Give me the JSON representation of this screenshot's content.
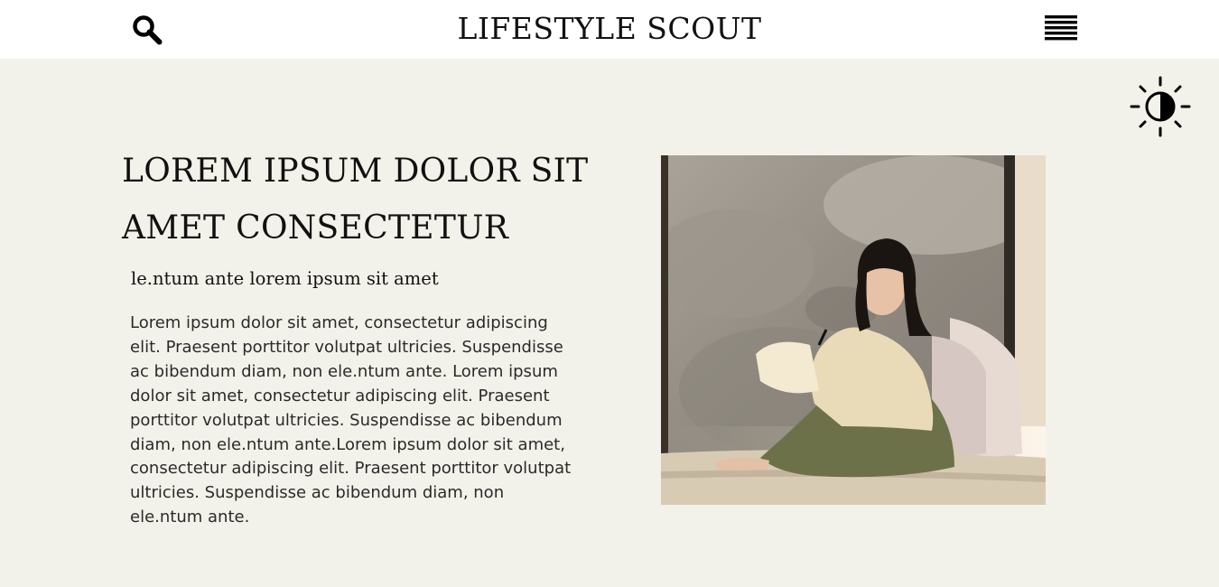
{
  "header": {
    "brand": "LIFESTYLE SCOUT",
    "search_icon": "search-icon",
    "menu_icon": "hamburger-menu-icon"
  },
  "theme_toggle": {
    "icon": "contrast-sun-icon"
  },
  "article": {
    "headline": "LOREM IPSUM DOLOR SIT AMET CONSECTETUR",
    "subheading": "le.ntum ante lorem ipsum sit amet",
    "body": "Lorem ipsum dolor sit amet, consectetur adipiscing elit. Praesent porttitor volutpat ultricies. Suspendisse ac bibendum diam, non ele.ntum ante. Lorem ipsum dolor sit amet, consectetur adipiscing elit. Praesent porttitor volutpat ultricies. Suspendisse ac bibendum diam, non ele.ntum ante.Lorem ipsum dolor sit amet, consectetur adipiscing elit. Praesent porttitor volutpat ultricies. Suspendisse ac bibendum diam, non ele.ntum ante."
  },
  "photo": {
    "subject": "woman reading on a window seat"
  },
  "colors": {
    "header_bg": "#ffffff",
    "page_bg": "#f3f2ea",
    "text": "#111111"
  }
}
